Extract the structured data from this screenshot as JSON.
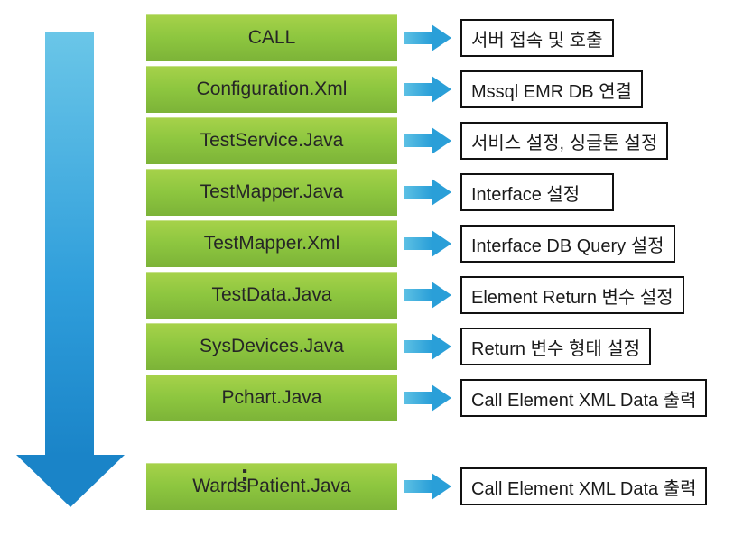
{
  "flowDirection": "top-to-bottom",
  "ellipsis": "…",
  "stages": [
    {
      "name": "CALL",
      "desc": "서버 접속 및 호출"
    },
    {
      "name": "Configuration.Xml",
      "desc": "Mssql EMR DB 연결"
    },
    {
      "name": "TestService.Java",
      "desc": "서비스 설정, 싱글톤 설정"
    },
    {
      "name": "TestMapper.Java",
      "desc": "Interface 설정"
    },
    {
      "name": "TestMapper.Xml",
      "desc": "Interface DB Query 설정"
    },
    {
      "name": "TestData.Java",
      "desc": "Element  Return 변수 설정"
    },
    {
      "name": "SysDevices.Java",
      "desc": "Return 변수 형태 설정"
    },
    {
      "name": "Pchart.Java",
      "desc": "Call Element  XML Data 출력"
    },
    {
      "name": "WardsPatient.Java",
      "desc": "Call Element  XML Data 출력"
    }
  ],
  "colors": {
    "stageFill": "#8dc63f",
    "arrowFill": "#2a9fd8",
    "flowArrow": "#1a84c8"
  }
}
